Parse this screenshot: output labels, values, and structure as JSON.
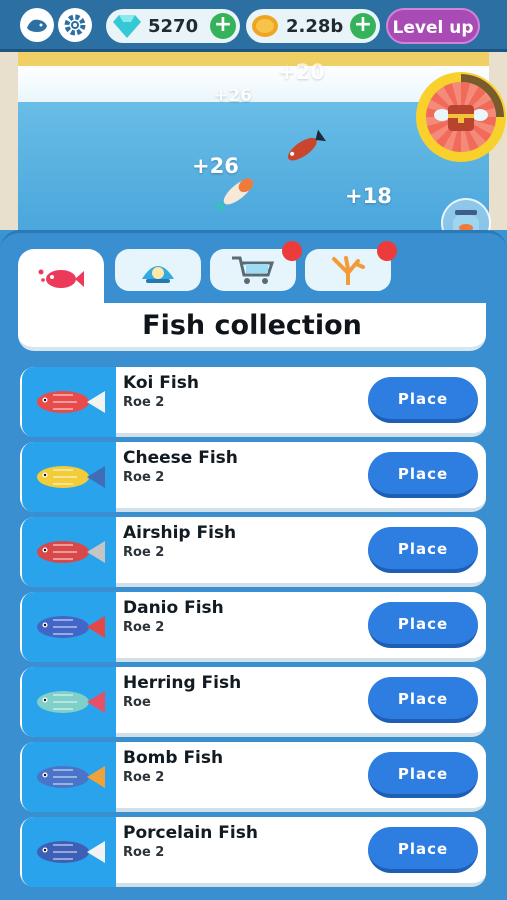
{
  "currency": {
    "gems": "5270",
    "coins": "2.28b"
  },
  "buttons": {
    "level_up": "Level up",
    "plus": "+"
  },
  "floating_numbers": [
    "+20",
    "+26",
    "+26",
    "+18"
  ],
  "tabs": [
    {
      "icon": "fish-icon",
      "active": true
    },
    {
      "icon": "pearl-shell-icon",
      "active": false
    },
    {
      "icon": "shopping-cart-icon",
      "active": false,
      "badge": true
    },
    {
      "icon": "coral-icon",
      "active": false,
      "badge": true
    }
  ],
  "panel": {
    "title": "Fish collection"
  },
  "fish": [
    {
      "name": "Koi Fish",
      "sub": "Roe 2",
      "action": "Place",
      "body": "#e84b4b",
      "tail": "#f2f2f2"
    },
    {
      "name": "Cheese Fish",
      "sub": "Roe 2",
      "action": "Place",
      "body": "#f2cd3a",
      "tail": "#3f6db8"
    },
    {
      "name": "Airship Fish",
      "sub": "Roe 2",
      "action": "Place",
      "body": "#d94848",
      "tail": "#c5c5c5"
    },
    {
      "name": "Danio Fish",
      "sub": "Roe 2",
      "action": "Place",
      "body": "#4266c8",
      "tail": "#e24848"
    },
    {
      "name": "Herring Fish",
      "sub": "Roe",
      "action": "Place",
      "body": "#7fd0c8",
      "tail": "#e85068"
    },
    {
      "name": "Bomb Fish",
      "sub": "Roe 2",
      "action": "Place",
      "body": "#4a74c9",
      "tail": "#f0a23a"
    },
    {
      "name": "Porcelain Fish",
      "sub": "Roe 2",
      "action": "Place",
      "body": "#3e5fb6",
      "tail": "#f2f2f2"
    }
  ]
}
